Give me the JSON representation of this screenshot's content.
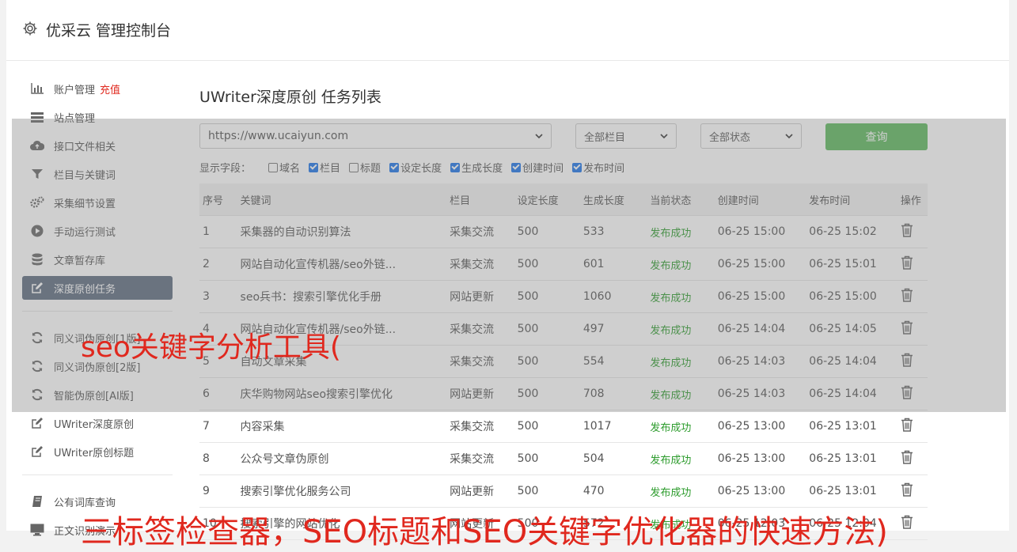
{
  "header": {
    "title": "优采云 管理控制台",
    "icon": "gear-icon"
  },
  "sidebar": {
    "account": {
      "label": "账户管理",
      "tag": "充值",
      "icon": "bar-chart-icon"
    },
    "items": [
      {
        "label": "站点管理",
        "icon": "server-icon"
      },
      {
        "label": "接口文件相关",
        "icon": "cloud-upload-icon"
      },
      {
        "label": "栏目与关键词",
        "icon": "filter-icon"
      },
      {
        "label": "采集细节设置",
        "icon": "gears-icon"
      },
      {
        "label": "手动运行测试",
        "icon": "play-circle-icon"
      },
      {
        "label": "文章暂存库",
        "icon": "database-icon"
      },
      {
        "label": "深度原创任务",
        "icon": "edit-icon"
      }
    ],
    "items2": [
      {
        "label": "同义词伪原创[1版]",
        "icon": "refresh-icon"
      },
      {
        "label": "同义词伪原创[2版]",
        "icon": "refresh-icon"
      },
      {
        "label": "智能伪原创[AI版]",
        "icon": "refresh-icon"
      },
      {
        "label": "UWriter深度原创",
        "icon": "edit-icon"
      },
      {
        "label": "UWriter原创标题",
        "icon": "edit-icon"
      }
    ],
    "items3": [
      {
        "label": "公有词库查询",
        "icon": "book-icon"
      },
      {
        "label": "正文识别演示",
        "icon": "monitor-icon"
      }
    ]
  },
  "page": {
    "title": "UWriter深度原创 任务列表"
  },
  "filters": {
    "site": "https://www.ucaiyun.com",
    "category": "全部栏目",
    "status": "全部状态",
    "query_label": "查询"
  },
  "fields": {
    "label": "显示字段：",
    "options": [
      {
        "label": "域名",
        "checked": false
      },
      {
        "label": "栏目",
        "checked": true
      },
      {
        "label": "标题",
        "checked": false
      },
      {
        "label": "设定长度",
        "checked": true
      },
      {
        "label": "生成长度",
        "checked": true
      },
      {
        "label": "创建时间",
        "checked": true
      },
      {
        "label": "发布时间",
        "checked": true
      }
    ]
  },
  "table": {
    "columns": [
      "序号",
      "关键词",
      "栏目",
      "设定长度",
      "生成长度",
      "当前状态",
      "创建时间",
      "发布时间",
      "操作"
    ],
    "rows": [
      [
        "1",
        "采集器的自动识别算法",
        "采集交流",
        "500",
        "533",
        "发布成功",
        "06-25 15:00",
        "06-25 15:02"
      ],
      [
        "2",
        "网站自动化宣传机器/seo外链...",
        "采集交流",
        "500",
        "601",
        "发布成功",
        "06-25 15:00",
        "06-25 15:01"
      ],
      [
        "3",
        "seo兵书：搜索引擎优化手册",
        "网站更新",
        "500",
        "1060",
        "发布成功",
        "06-25 15:00",
        "06-25 15:00"
      ],
      [
        "4",
        "网站自动化宣传机器/seo外链...",
        "采集交流",
        "500",
        "497",
        "发布成功",
        "06-25 14:04",
        "06-25 14:05"
      ],
      [
        "5",
        "自动文章采集",
        "采集交流",
        "500",
        "554",
        "发布成功",
        "06-25 14:03",
        "06-25 14:04"
      ],
      [
        "6",
        "庆华购物网站seo搜索引擎优化",
        "网站更新",
        "500",
        "708",
        "发布成功",
        "06-25 14:03",
        "06-25 14:04"
      ],
      [
        "7",
        "内容采集",
        "采集交流",
        "500",
        "1017",
        "发布成功",
        "06-25 13:00",
        "06-25 13:01"
      ],
      [
        "8",
        "公众号文章伪原创",
        "采集交流",
        "500",
        "504",
        "发布成功",
        "06-25 13:00",
        "06-25 13:01"
      ],
      [
        "9",
        "搜索引擎优化服务公司",
        "网站更新",
        "500",
        "470",
        "发布成功",
        "06-25 13:00",
        "06-25 13:01"
      ],
      [
        "10",
        "搜索引擎的网站优化",
        "网站更新",
        "500",
        "572",
        "发布成功",
        "06-25 12:03",
        "06-25 12:04"
      ]
    ]
  },
  "overlay": {
    "text1": "seo关键字分析工具(",
    "text2": "三标签检查器，SEO标题和SEO关键字优化器的快速方法)"
  },
  "colors": {
    "active_nav": "#5d6b7f",
    "query_button": "#5cb85c",
    "success": "#2d9c2d",
    "overlay_text": "#e0281e"
  }
}
